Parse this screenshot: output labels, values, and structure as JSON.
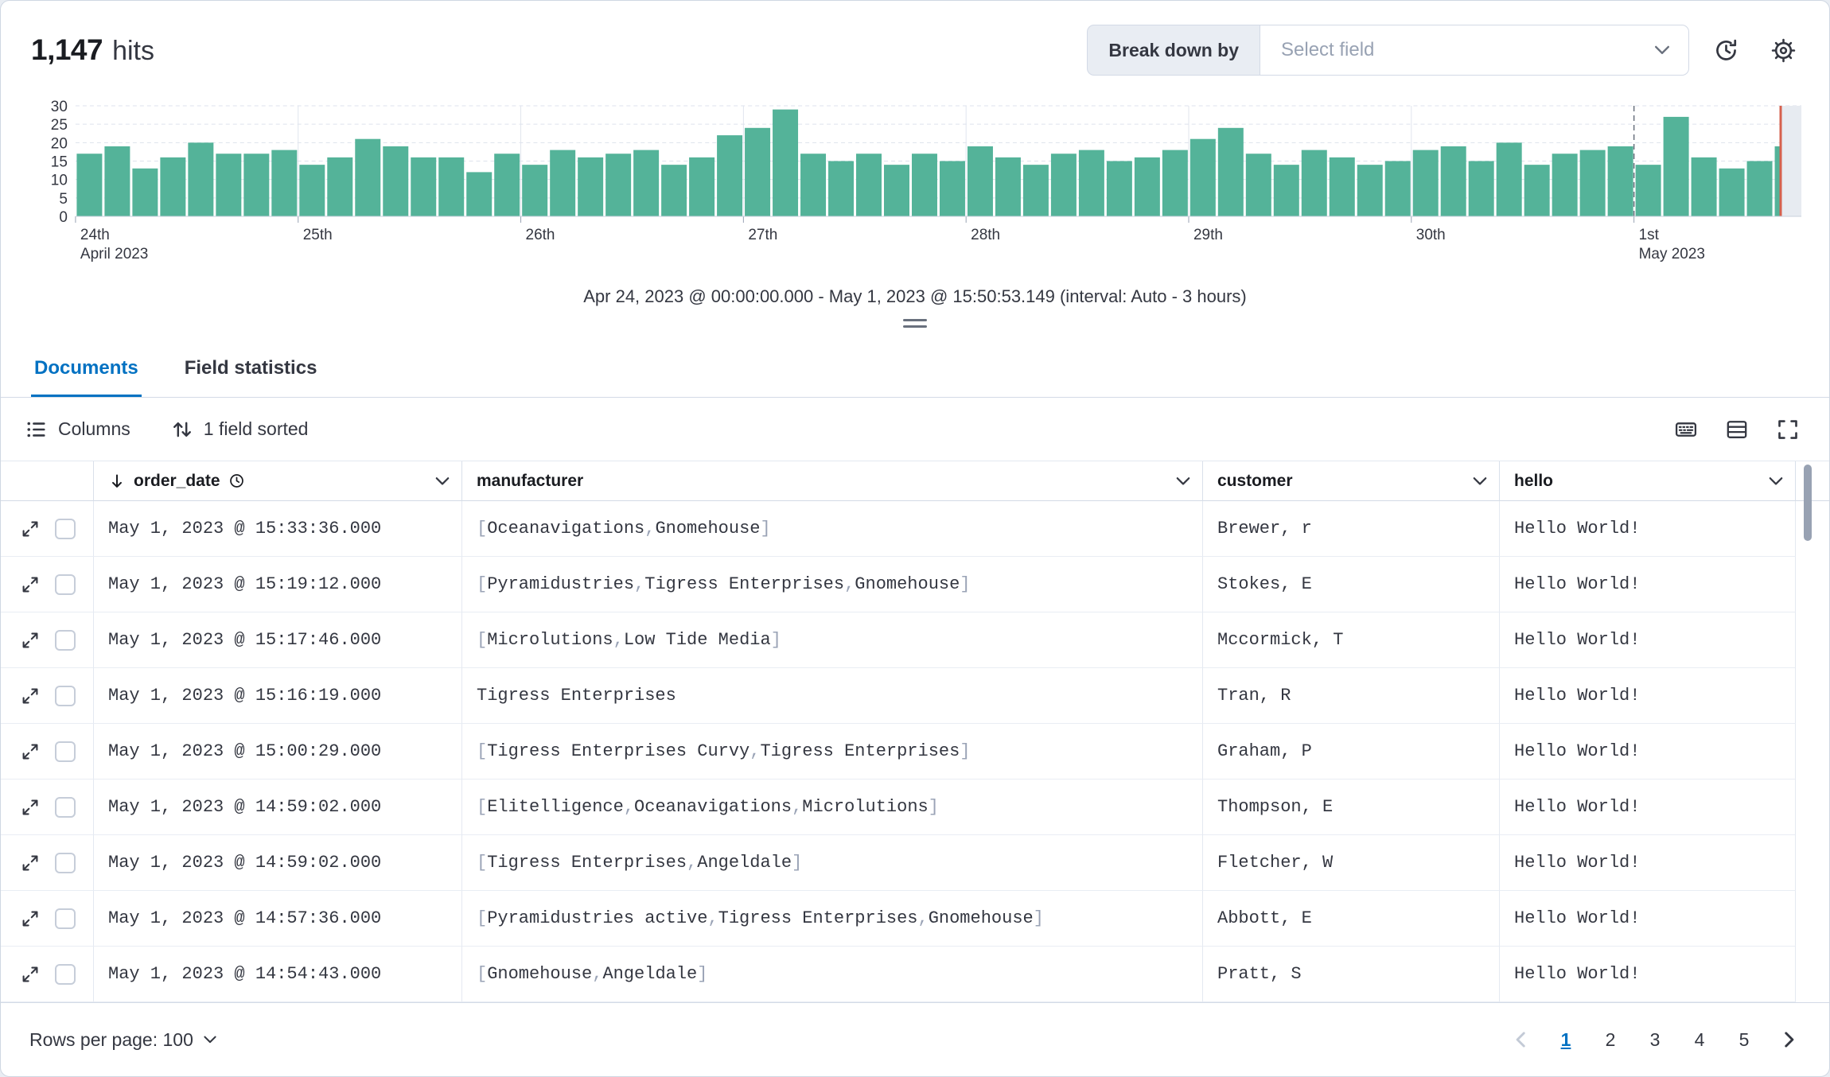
{
  "header": {
    "hits_count": "1,147",
    "hits_label": "hits",
    "breakdown_label": "Break down by",
    "breakdown_value": "Select field"
  },
  "chart_caption": "Apr 24, 2023 @ 00:00:00.000 - May 1, 2023 @ 15:50:53.149 (interval: Auto - 3 hours)",
  "chart_data": {
    "type": "bar",
    "title": "Document count histogram",
    "x_start": "Apr 24, 2023 @ 00:00:00.000",
    "x_end": "May 1, 2023 @ 15:50:53.149",
    "interval": "Auto - 3 hours",
    "ylim": [
      0,
      30
    ],
    "yticks": [
      0,
      5,
      10,
      15,
      20,
      25,
      30
    ],
    "bar_color": "#54b399",
    "end_marker_color": "#d6604d",
    "end_marker_frac": 0.988,
    "day_ticks": [
      {
        "label": "24th",
        "sublabel": "April 2023",
        "frac": 0
      },
      {
        "label": "25th",
        "frac": 0.129
      },
      {
        "label": "26th",
        "frac": 0.258
      },
      {
        "label": "27th",
        "frac": 0.387
      },
      {
        "label": "28th",
        "frac": 0.516
      },
      {
        "label": "29th",
        "frac": 0.645
      },
      {
        "label": "30th",
        "frac": 0.774
      },
      {
        "label": "1st",
        "sublabel": "May 2023",
        "frac": 0.903,
        "dashed": true
      }
    ],
    "values": [
      17,
      19,
      13,
      16,
      20,
      17,
      17,
      18,
      14,
      16,
      21,
      19,
      16,
      16,
      12,
      17,
      14,
      18,
      16,
      17,
      18,
      14,
      16,
      22,
      24,
      29,
      17,
      15,
      17,
      14,
      17,
      15,
      19,
      16,
      14,
      17,
      18,
      15,
      16,
      18,
      21,
      24,
      17,
      14,
      18,
      16,
      14,
      15,
      18,
      19,
      15,
      20,
      14,
      17,
      18,
      19,
      14,
      27,
      16,
      13,
      15,
      19
    ]
  },
  "tabs": [
    {
      "label": "Documents",
      "active": true
    },
    {
      "label": "Field statistics",
      "active": false
    }
  ],
  "toolbar": {
    "columns_label": "Columns",
    "sorted_label": "1 field sorted"
  },
  "table": {
    "columns": [
      "order_date",
      "manufacturer",
      "customer",
      "hello"
    ],
    "rows": [
      {
        "order_date": "May 1, 2023 @ 15:33:36.000",
        "manufacturer": [
          "Oceanavigations",
          "Gnomehouse"
        ],
        "customer": "Brewer, r",
        "hello": "Hello World!"
      },
      {
        "order_date": "May 1, 2023 @ 15:19:12.000",
        "manufacturer": [
          "Pyramidustries",
          "Tigress Enterprises",
          "Gnomehouse"
        ],
        "customer": "Stokes, E",
        "hello": "Hello World!"
      },
      {
        "order_date": "May 1, 2023 @ 15:17:46.000",
        "manufacturer": [
          "Microlutions",
          "Low Tide Media"
        ],
        "customer": "Mccormick, T",
        "hello": "Hello World!"
      },
      {
        "order_date": "May 1, 2023 @ 15:16:19.000",
        "manufacturer": "Tigress Enterprises",
        "customer": "Tran, R",
        "hello": "Hello World!"
      },
      {
        "order_date": "May 1, 2023 @ 15:00:29.000",
        "manufacturer": [
          "Tigress Enterprises Curvy",
          "Tigress Enterprises"
        ],
        "customer": "Graham, P",
        "hello": "Hello World!"
      },
      {
        "order_date": "May 1, 2023 @ 14:59:02.000",
        "manufacturer": [
          "Elitelligence",
          "Oceanavigations",
          "Microlutions"
        ],
        "customer": "Thompson, E",
        "hello": "Hello World!"
      },
      {
        "order_date": "May 1, 2023 @ 14:59:02.000",
        "manufacturer": [
          "Tigress Enterprises",
          "Angeldale"
        ],
        "customer": "Fletcher, W",
        "hello": "Hello World!"
      },
      {
        "order_date": "May 1, 2023 @ 14:57:36.000",
        "manufacturer": [
          "Pyramidustries active",
          "Tigress Enterprises",
          "Gnomehouse"
        ],
        "customer": "Abbott, E",
        "hello": "Hello World!"
      },
      {
        "order_date": "May 1, 2023 @ 14:54:43.000",
        "manufacturer": [
          "Gnomehouse",
          "Angeldale"
        ],
        "customer": "Pratt, S",
        "hello": "Hello World!"
      }
    ]
  },
  "footer": {
    "rows_per_page_label": "Rows per page: 100",
    "pages": [
      "1",
      "2",
      "3",
      "4",
      "5"
    ],
    "active_page": "1"
  },
  "icons": {
    "time-refresh-icon": "circular-arrow-with-clock",
    "gear-icon": "gear",
    "chevron-down-icon": "chevron-down",
    "columns-icon": "bulleted-list",
    "sort-fields-icon": "up-down-arrows",
    "keyboard-icon": "keyboard",
    "density-icon": "table-rows",
    "fullscreen-icon": "expand-corners",
    "sort-desc-icon": "arrow-down",
    "clock-icon": "clock",
    "expand-icon": "diagonal-expand",
    "chevron-left-icon": "chevron-left",
    "chevron-right-icon": "chevron-right"
  },
  "colors": {
    "accent_blue": "#0071c2",
    "bar_green": "#54b399",
    "text": "#343741",
    "border": "#d3dae6",
    "placeholder": "#98a2b3"
  }
}
